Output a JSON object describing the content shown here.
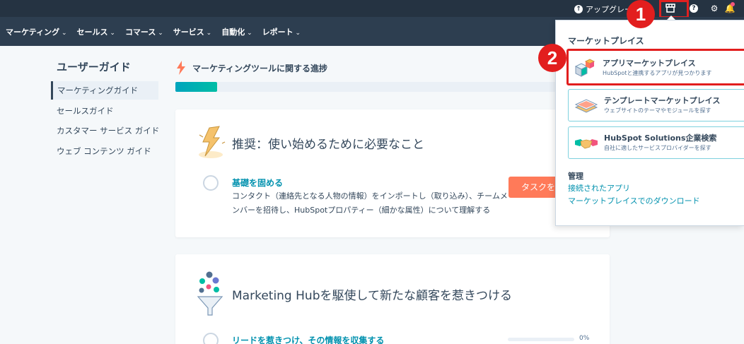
{
  "topbar": {
    "upgrade_label": "アップグレー",
    "upgrade_icon": "arrow-up-circle-icon",
    "icons": [
      "marketplace-icon",
      "help-icon",
      "gear-icon",
      "bell-icon"
    ]
  },
  "nav": {
    "items": [
      "マーケティング",
      "セールス",
      "コマース",
      "サービス",
      "自動化",
      "レポート"
    ]
  },
  "badges": {
    "first": "1",
    "second": "2"
  },
  "sidebar": {
    "title": "ユーザーガイド",
    "items": [
      "マーケティングガイド",
      "セールスガイド",
      "カスタマー サービス ガイド",
      "ウェブ コンテンツ ガイド"
    ],
    "active_index": 0
  },
  "progress": {
    "title": "マーケティングツールに関する進捗",
    "fraction": 0.11
  },
  "card1": {
    "title": "推奨：使い始めるために必要なこと",
    "task_title": "基礎を固める",
    "task_desc": "コンタクト（連絡先となる人物の情報）をインポートし（取り込み）、チームメンバーを招待し、HubSpotプロパティー（細かな属性）について理解する",
    "task_button": "タスクを開"
  },
  "card2": {
    "title": "Marketing Hubを駆使して新たな顧客を惹きつける",
    "task_title": "リードを惹きつけ、その情報を収集する",
    "task_percent": "0%",
    "task_fraction": 0
  },
  "dropdown": {
    "heading": "マーケットプレイス",
    "cards": [
      {
        "title": "アプリマーケットプレイス",
        "subtitle": "HubSpotと連携するアプリが見つかります",
        "icon": "app-cubes-icon"
      },
      {
        "title": "テンプレートマーケットプレイス",
        "subtitle": "ウェブサイトのテーマやモジュールを探す",
        "icon": "template-layers-icon"
      },
      {
        "title": "HubSpot Solutions企業検索",
        "subtitle": "自社に適したサービスプロバイダーを探す",
        "icon": "handshake-icon"
      }
    ],
    "manage_heading": "管理",
    "links": [
      "接続されたアプリ",
      "マーケットプレイスでのダウンロード"
    ]
  },
  "colors": {
    "topbar": "#253342",
    "navbar": "#2d3e50",
    "accent_teal": "#00a4bd",
    "link": "#0091ae",
    "button_orange": "#ff7a59",
    "highlight_red": "#e21e1e"
  }
}
